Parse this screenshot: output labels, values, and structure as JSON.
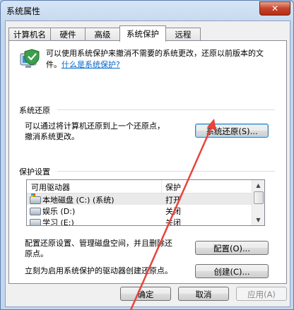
{
  "window": {
    "title": "系统属性",
    "close_label": "✕"
  },
  "tabs": [
    {
      "label": "计算机名",
      "active": false
    },
    {
      "label": "硬件",
      "active": false
    },
    {
      "label": "高级",
      "active": false
    },
    {
      "label": "系统保护",
      "active": true
    },
    {
      "label": "远程",
      "active": false
    }
  ],
  "intro": {
    "text": "可以使用系统保护来撤消不需要的系统更改，还原以前版本的文件。",
    "link": "什么是系统保护?"
  },
  "restore": {
    "title": "系统还原",
    "desc_line1": "可以通过将计算机还原到上一个还原点，",
    "desc_line2": "撤消系统更改。",
    "button": "系统还原(S)..."
  },
  "protection": {
    "title": "保护设置",
    "columns": {
      "drive": "可用驱动器",
      "protection": "保护"
    },
    "drives": [
      {
        "name": "本地磁盘 (C:) (系统)",
        "protection": "打开",
        "icon": "system-drive-icon"
      },
      {
        "name": "娱乐 (D:)",
        "protection": "关闭",
        "icon": "drive-icon"
      },
      {
        "name": "学习 (E:)",
        "protection": "关闭",
        "icon": "drive-icon"
      }
    ],
    "configure_text_line1": "配置还原设置、管理磁盘空间，并且删除还",
    "configure_text_line2": "原点。",
    "configure_button": "配置(O)...",
    "create_text": "立刻为启用系统保护的驱动器创建还原点。",
    "create_button": "创建(C)..."
  },
  "footer": {
    "ok": "确定",
    "cancel": "取消",
    "apply": "应用(A)"
  },
  "colors": {
    "annotation_arrow": "#e8443a",
    "link": "#0066cc",
    "title_bar": "#c3d6ee"
  }
}
